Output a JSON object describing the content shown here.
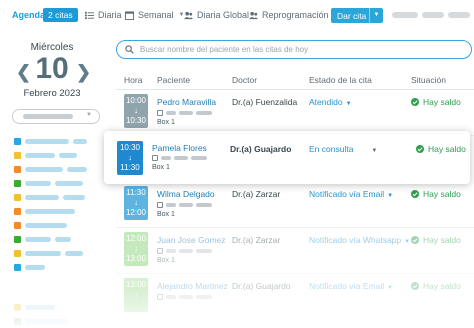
{
  "topbar": {
    "agenda_label": "Agenda",
    "citas_badge": "2 citas",
    "tabs": [
      {
        "label": "Diaria",
        "icon": "list-icon"
      },
      {
        "label": "Semanal",
        "icon": "calendar-week-icon"
      },
      {
        "label": "Diaria Global",
        "icon": "users-icon"
      },
      {
        "label": "Reprogramación",
        "icon": "users-icon"
      }
    ],
    "dar_cita_label": "Dar cita"
  },
  "sidebar": {
    "day_name": "Miércoles",
    "day_number": "10",
    "month_year": "Febrero 2023",
    "prev_icon": "chevron-left-icon",
    "next_icon": "chevron-right-icon"
  },
  "search": {
    "placeholder": "Buscar nombre del paciente en las citas de hoy",
    "value": ""
  },
  "table": {
    "headers": {
      "hora": "Hora",
      "paciente": "Paciente",
      "doctor": "Doctor",
      "estado": "Estado de la cita",
      "situacion": "Situación"
    },
    "rows": [
      {
        "start": "10:00",
        "end": "10:30",
        "patient": "Pedro Maravilla",
        "box": "Box 1",
        "doctor": "Dr.(a) Fuenzalida",
        "status": "Atendido",
        "situation": "Hay saldo",
        "color": "#90a4ae"
      },
      {
        "start": "10:30",
        "end": "11:30",
        "patient": "Pamela Flores",
        "box": "Box 1",
        "doctor": "Dr.(a) Guajardo",
        "status": "En consulta",
        "situation": "Hay saldo",
        "color": "#1e88d1"
      },
      {
        "start": "11:30",
        "end": "12:00",
        "patient": "Wilma Delgado",
        "box": "Box 1",
        "doctor": "Dr.(a) Zarzar",
        "status": "Notificado vía Email",
        "situation": "Hay saldo",
        "color": "#5fb3e0"
      },
      {
        "start": "12:00",
        "end": "13:00",
        "patient": "Juan Jose Gomez",
        "box": "Box 1",
        "doctor": "Dr.(a) Zarzar",
        "status": "Notificado vía Whatsapp",
        "situation": "Hay saldo",
        "color": "#7ccf6e"
      },
      {
        "start": "13:00",
        "end": "",
        "patient": "Alejandro Martinez",
        "box": "",
        "doctor": "Dr.(a) Guajardo",
        "status": "Notificado vía Email",
        "situation": "Hay saldo",
        "color": "#7ccf6e"
      }
    ]
  },
  "colors": {
    "accent": "#1e9ad6",
    "link": "#1e7fb8",
    "success": "#2e9e4f"
  }
}
